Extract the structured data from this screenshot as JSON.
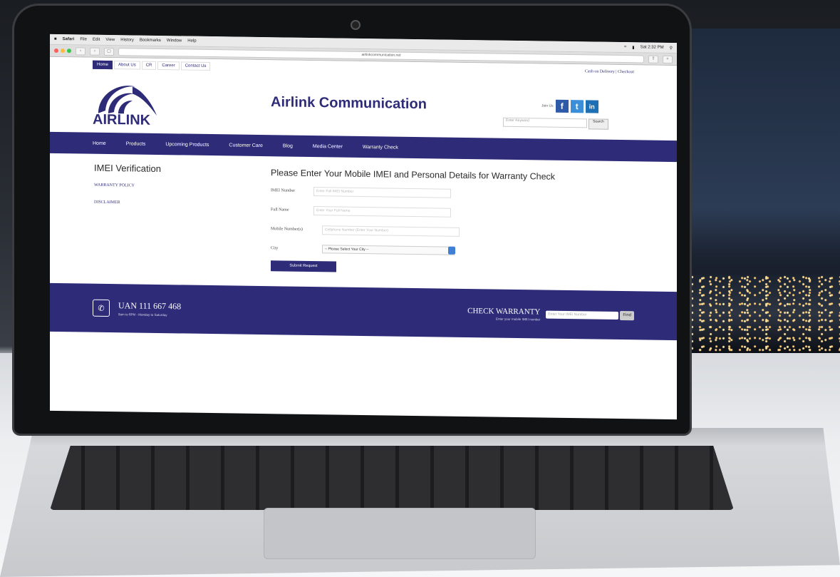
{
  "menubar": {
    "app": "Safari",
    "items": [
      "File",
      "Edit",
      "View",
      "History",
      "Bookmarks",
      "Window",
      "Help"
    ],
    "clock": "Sat 2:32 PM"
  },
  "browser": {
    "url": "airlinkcommunication.net"
  },
  "site": {
    "topnav": [
      "Home",
      "About Us",
      "CR",
      "Career",
      "Contact Us"
    ],
    "cod_text": "Cash on Delivery | Checkout",
    "logo_text": "AIRLINK",
    "title": "Airlink Communication",
    "join_text": "Join Us",
    "social": [
      "f",
      "t",
      "in"
    ],
    "search": {
      "placeholder": "Enter Keyword",
      "button": "Search"
    },
    "nav": [
      "Home",
      "Products",
      "Upcoming Products",
      "Customer Care",
      "Blog",
      "Media Center",
      "Warranty Check"
    ],
    "sidebar": {
      "title": "IMEI Verification",
      "links": [
        "WARRANTY POLICY",
        "DISCLAIMER"
      ]
    },
    "form": {
      "title": "Please Enter Your Mobile IMEI and Personal Details for Warranty Check",
      "fields": [
        {
          "label": "IMEI Number",
          "placeholder": "Enter Full IMEI Number"
        },
        {
          "label": "Full Name",
          "placeholder": "Enter Your Full Name"
        },
        {
          "label": "Mobile Number(s)",
          "placeholder": "Cellphone Number (Enter Your Number)"
        }
      ],
      "city_label": "City",
      "city_value": "-- Please Select Your City --",
      "submit": "Submit Request"
    },
    "footer": {
      "uan": "UAN 111 667 468",
      "uan_sub": "9am to 6PM - Monday to Saturday",
      "cw_title": "CHECK WARRANTY",
      "cw_sub": "Enter your mobile IMEI number",
      "cw_placeholder": "Enter Your IMEI Number",
      "cw_button": "Find"
    }
  },
  "colors": {
    "brand": "#2e2b78",
    "accent": "#3f7fd6"
  }
}
